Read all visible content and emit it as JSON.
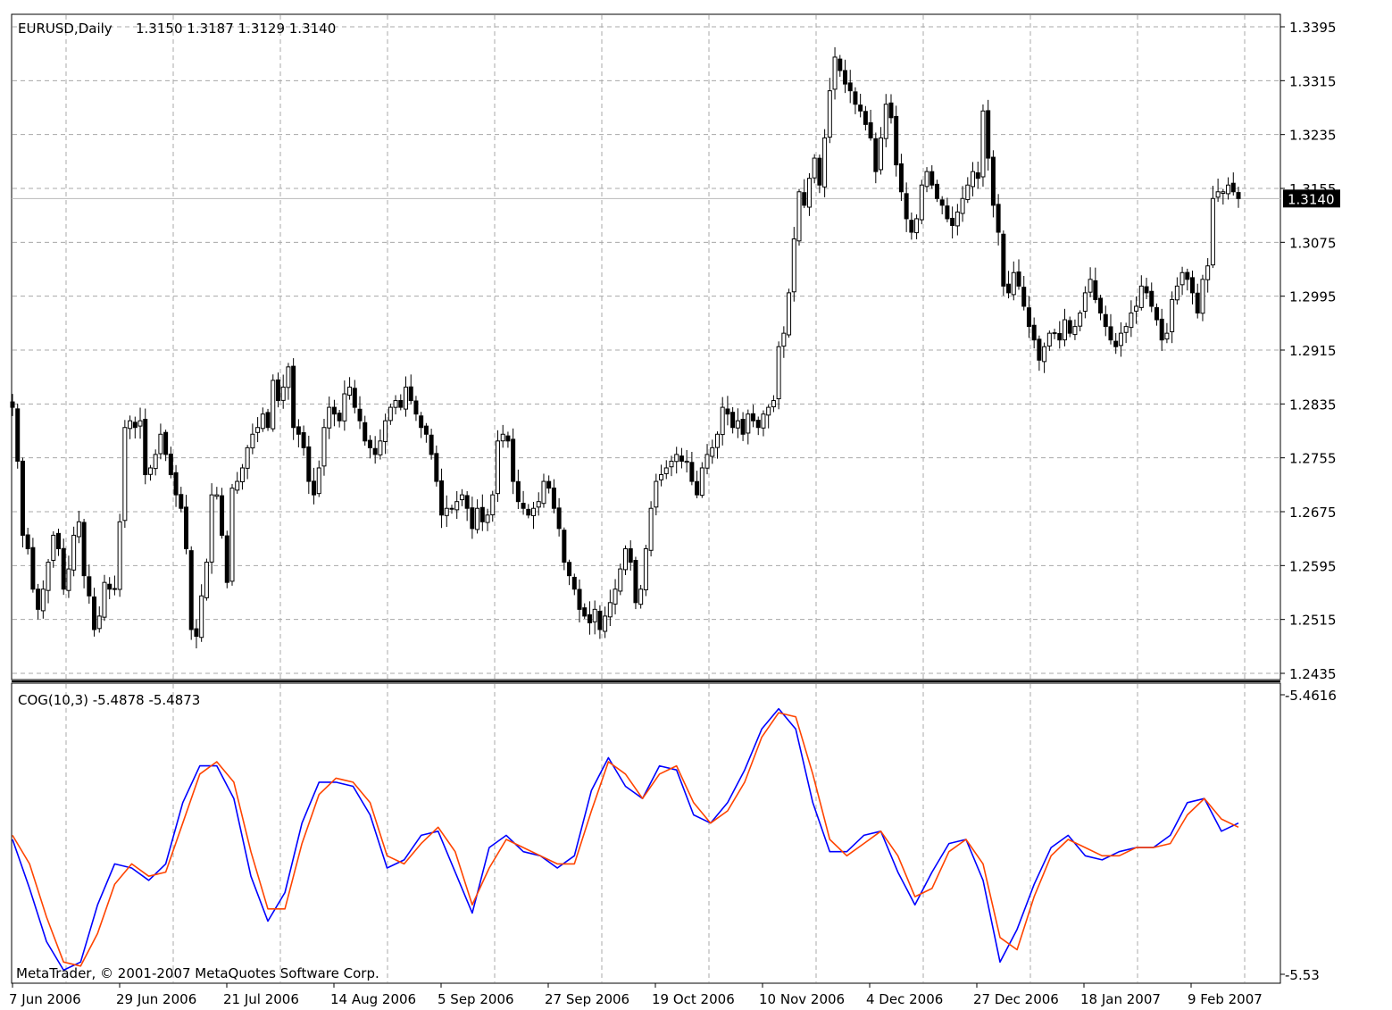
{
  "chart_data": [
    {
      "type": "candlestick",
      "title": "EURUSD,Daily",
      "ohlc_label": "1.3150 1.3187 1.3129 1.3140",
      "last_price": 1.314,
      "last_price_label": "1.3140",
      "ylim": [
        1.2435,
        1.3395
      ],
      "y_ticks": [
        "1.3395",
        "1.3315",
        "1.3235",
        "1.3155",
        "1.3075",
        "1.2995",
        "1.2915",
        "1.2835",
        "1.2755",
        "1.2675",
        "1.2595",
        "1.2515",
        "1.2435"
      ],
      "x_ticks": [
        "7 Jun 2006",
        "29 Jun 2006",
        "21 Jul 2006",
        "14 Aug 2006",
        "5 Sep 2006",
        "27 Sep 2006",
        "19 Oct 2006",
        "10 Nov 2006",
        "4 Dec 2006",
        "27 Dec 2006",
        "18 Jan 2007",
        "9 Feb 2007"
      ],
      "grid": true,
      "closes": [
        1.283,
        1.275,
        1.264,
        1.262,
        1.256,
        1.253,
        1.256,
        1.26,
        1.264,
        1.262,
        1.256,
        1.259,
        1.264,
        1.266,
        1.258,
        1.255,
        1.25,
        1.252,
        1.257,
        1.256,
        1.256,
        1.266,
        1.28,
        1.281,
        1.28,
        1.281,
        1.273,
        1.274,
        1.276,
        1.279,
        1.276,
        1.273,
        1.27,
        1.268,
        1.262,
        1.25,
        1.249,
        1.255,
        1.26,
        1.27,
        1.27,
        1.264,
        1.257,
        1.271,
        1.272,
        1.274,
        1.277,
        1.279,
        1.28,
        1.282,
        1.28,
        1.287,
        1.284,
        1.286,
        1.289,
        1.28,
        1.279,
        1.277,
        1.272,
        1.27,
        1.274,
        1.28,
        1.283,
        1.282,
        1.281,
        1.285,
        1.286,
        1.283,
        1.281,
        1.278,
        1.277,
        1.276,
        1.278,
        1.281,
        1.283,
        1.284,
        1.283,
        1.286,
        1.284,
        1.282,
        1.28,
        1.279,
        1.276,
        1.272,
        1.267,
        1.268,
        1.268,
        1.269,
        1.27,
        1.268,
        1.265,
        1.268,
        1.266,
        1.267,
        1.27,
        1.278,
        1.279,
        1.278,
        1.272,
        1.269,
        1.268,
        1.267,
        1.268,
        1.269,
        1.272,
        1.271,
        1.268,
        1.265,
        1.26,
        1.258,
        1.256,
        1.253,
        1.252,
        1.251,
        1.253,
        1.25,
        1.252,
        1.254,
        1.256,
        1.259,
        1.262,
        1.26,
        1.254,
        1.256,
        1.262,
        1.268,
        1.272,
        1.273,
        1.274,
        1.275,
        1.276,
        1.275,
        1.275,
        1.272,
        1.27,
        1.274,
        1.276,
        1.277,
        1.279,
        1.283,
        1.282,
        1.28,
        1.281,
        1.279,
        1.282,
        1.281,
        1.28,
        1.282,
        1.283,
        1.284,
        1.292,
        1.294,
        1.3,
        1.308,
        1.315,
        1.313,
        1.317,
        1.32,
        1.316,
        1.323,
        1.33,
        1.335,
        1.333,
        1.331,
        1.33,
        1.328,
        1.327,
        1.325,
        1.323,
        1.318,
        1.323,
        1.328,
        1.326,
        1.319,
        1.315,
        1.311,
        1.309,
        1.311,
        1.316,
        1.318,
        1.316,
        1.314,
        1.313,
        1.311,
        1.31,
        1.312,
        1.314,
        1.316,
        1.318,
        1.317,
        1.327,
        1.32,
        1.313,
        1.309,
        1.301,
        1.3,
        1.303,
        1.301,
        1.298,
        1.295,
        1.293,
        1.29,
        1.292,
        1.294,
        1.294,
        1.293,
        1.296,
        1.294,
        1.295,
        1.297,
        1.3,
        1.302,
        1.299,
        1.297,
        1.295,
        1.293,
        1.292,
        1.294,
        1.295,
        1.297,
        1.298,
        1.301,
        1.3,
        1.298,
        1.296,
        1.293,
        1.294,
        1.299,
        1.301,
        1.303,
        1.302,
        1.3,
        1.297,
        1.302,
        1.304,
        1.314,
        1.315,
        1.315,
        1.316,
        1.315,
        1.314
      ],
      "bars_total": 250
    },
    {
      "type": "line",
      "title": "COG(10,3) -5.4878 -5.4873",
      "ylim": [
        -5.53,
        -5.4616
      ],
      "y_ticks": [
        "-5.4616",
        "-5.53"
      ],
      "grid": true,
      "series": [
        {
          "color": "#0000ff",
          "values": [
            -5.497,
            -5.509,
            -5.522,
            -5.529,
            -5.527,
            -5.513,
            -5.503,
            -5.504,
            -5.507,
            -5.503,
            -5.488,
            -5.479,
            -5.479,
            -5.487,
            -5.506,
            -5.517,
            -5.51,
            -5.493,
            -5.483,
            -5.483,
            -5.484,
            -5.491,
            -5.504,
            -5.502,
            -5.496,
            -5.495,
            -5.505,
            -5.515,
            -5.499,
            -5.496,
            -5.5,
            -5.501,
            -5.504,
            -5.501,
            -5.485,
            -5.477,
            -5.484,
            -5.487,
            -5.479,
            -5.48,
            -5.491,
            -5.493,
            -5.488,
            -5.48,
            -5.47,
            -5.465,
            -5.47,
            -5.488,
            -5.5,
            -5.5,
            -5.496,
            -5.495,
            -5.505,
            -5.513,
            -5.505,
            -5.498,
            -5.497,
            -5.507,
            -5.527,
            -5.519,
            -5.508,
            -5.499,
            -5.496,
            -5.501,
            -5.502,
            -5.5,
            -5.499,
            -5.499,
            -5.496,
            -5.488,
            -5.487,
            -5.495,
            -5.493
          ]
        },
        {
          "color": "#ff4400",
          "values": [
            -5.496,
            -5.503,
            -5.516,
            -5.527,
            -5.528,
            -5.52,
            -5.508,
            -5.503,
            -5.506,
            -5.505,
            -5.493,
            -5.481,
            -5.478,
            -5.483,
            -5.5,
            -5.514,
            -5.514,
            -5.498,
            -5.486,
            -5.482,
            -5.483,
            -5.488,
            -5.501,
            -5.503,
            -5.498,
            -5.494,
            -5.5,
            -5.513,
            -5.504,
            -5.497,
            -5.499,
            -5.501,
            -5.503,
            -5.503,
            -5.49,
            -5.478,
            -5.481,
            -5.487,
            -5.481,
            -5.479,
            -5.488,
            -5.493,
            -5.49,
            -5.483,
            -5.472,
            -5.466,
            -5.467,
            -5.481,
            -5.497,
            -5.501,
            -5.498,
            -5.495,
            -5.501,
            -5.511,
            -5.509,
            -5.5,
            -5.497,
            -5.503,
            -5.521,
            -5.524,
            -5.511,
            -5.501,
            -5.497,
            -5.499,
            -5.501,
            -5.501,
            -5.499,
            -5.499,
            -5.498,
            -5.491,
            -5.487,
            -5.492,
            -5.494
          ]
        }
      ]
    }
  ],
  "footer": {
    "copyright": "MetaTrader, © 2001-2007 MetaQuotes Software Corp."
  }
}
